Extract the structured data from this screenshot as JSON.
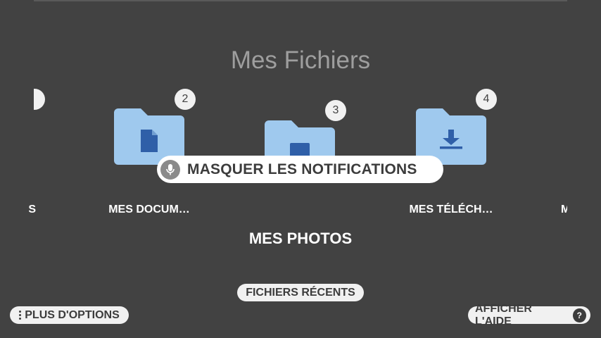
{
  "page": {
    "title": "Mes Fichiers"
  },
  "folders": [
    {
      "badge": "2",
      "label": "MES DOCUM…",
      "icon": "document-icon"
    },
    {
      "badge": "3",
      "label": "MES PHOTOS",
      "icon": "photo-icon"
    },
    {
      "badge": "4",
      "label": "MES TÉLÉCH…",
      "icon": "download-icon"
    }
  ],
  "edge_labels": {
    "left": "S",
    "right": "M"
  },
  "notification": {
    "label": "MASQUER LES NOTIFICATIONS",
    "icon": "microphone-icon"
  },
  "buttons": {
    "recent": "FICHIERS RÉCENTS",
    "options": "PLUS D'OPTIONS",
    "help": "AFFICHER L'AIDE",
    "help_symbol": "?"
  },
  "colors": {
    "background": "#424242",
    "folder": "#9fc9ee",
    "folder_icon": "#2f5fa8",
    "title": "#9e9e9e"
  }
}
